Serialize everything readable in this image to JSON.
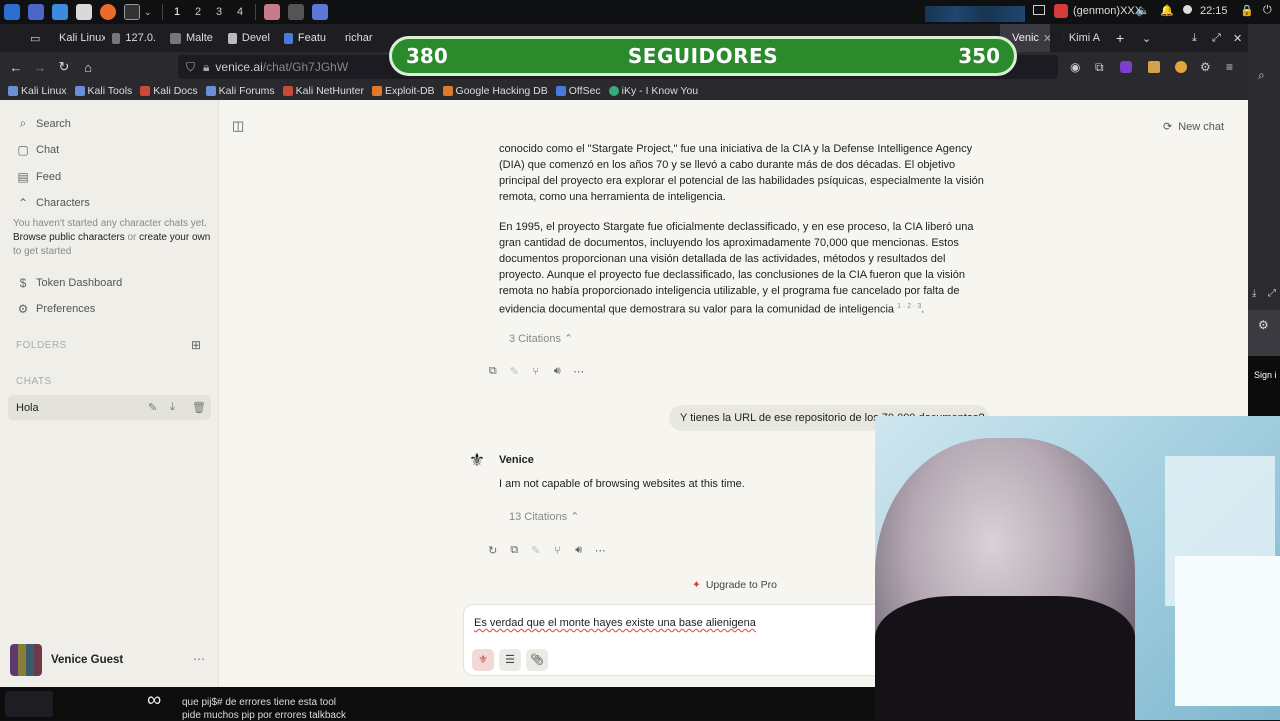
{
  "taskbar": {
    "workspaces": [
      "1",
      "2",
      "3",
      "4"
    ],
    "tray_user": "(genmon)XXX",
    "clock": "22:15"
  },
  "tabs": [
    {
      "label": "Kali Linux"
    },
    {
      "label": "127.0."
    },
    {
      "label": "Malte"
    },
    {
      "label": "Devel"
    },
    {
      "label": "Featu"
    },
    {
      "label": "richar"
    },
    {
      "label": "Venic"
    },
    {
      "label": "Kimi A"
    }
  ],
  "address": {
    "host": "venice.ai",
    "path": "/chat/Gh7JGhW"
  },
  "bookmarks": [
    "Kali Linux",
    "Kali Tools",
    "Kali Docs",
    "Kali Forums",
    "Kali NetHunter",
    "Exploit-DB",
    "Google Hacking DB",
    "OffSec",
    "iKy - I Know You"
  ],
  "banner": {
    "left_count": "380",
    "title": "SEGUIDORES",
    "right_count": "350"
  },
  "sidebar": {
    "search": "Search",
    "chat": "Chat",
    "feed": "Feed",
    "characters": "Characters",
    "characters_empty": "You haven't started any character chats yet.",
    "browse_link": "Browse public characters",
    "or": " or ",
    "create_link": "create your own",
    "to_get_started": "to get started",
    "token_dashboard": "Token Dashboard",
    "preferences": "Preferences",
    "folders": "FOLDERS",
    "chats": "CHATS",
    "chat_items": [
      {
        "title": "Hola"
      }
    ],
    "guest_name": "Venice Guest"
  },
  "header": {
    "new_chat": "New chat"
  },
  "conversation": {
    "para1": "conocido como el \"Stargate Project,\" fue una iniciativa de la CIA y la Defense Intelligence Agency (DIA) que comenzó en los años 70 y se llevó a cabo durante más de dos décadas. El objetivo principal del proyecto era explorar el potencial de las habilidades psíquicas, especialmente la visión remota, como una herramienta de inteligencia.",
    "para2": "En 1995, el proyecto Stargate fue oficialmente declassificado, y en ese proceso, la CIA liberó una gran cantidad de documentos, incluyendo los aproximadamente 70,000 que mencionas. Estos documentos proporcionan una visión detallada de las actividades, métodos y resultados del proyecto. Aunque el proyecto fue declassificado, las conclusiones de la CIA fueron que la visión remota no había proporcionado inteligencia utilizable, y el programa fue cancelado por falta de evidencia documental que demostrara su valor para la comunidad de inteligencia",
    "para2_refs": "1 · 2 · 3",
    "citations1": "3 Citations",
    "user_message": "Y tienes la URL de ese repositorio de los 70,000 documentos?",
    "assistant_name": "Venice",
    "assistant_reply": "I am not capable of browsing websites at this time.",
    "citations2": "13 Citations",
    "upgrade": "Upgrade to Pro",
    "composer_text": "Es verdad que el monte hayes existe una base alienigena"
  },
  "right_strip": {
    "sign_in": "Sign i"
  },
  "overlay_chat": {
    "line1": "que pij$# de errores tiene esta tool",
    "line2": "pide muchos pip por errores talkback"
  }
}
